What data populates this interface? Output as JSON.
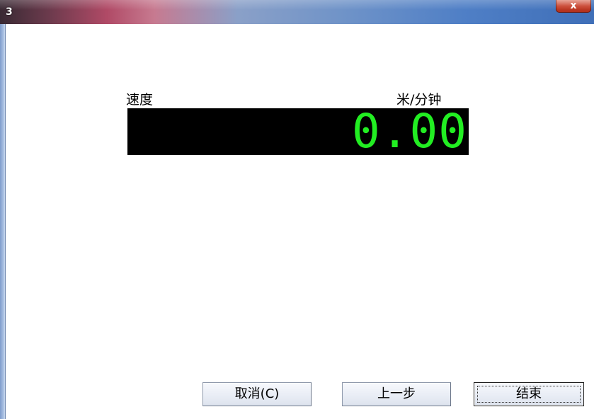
{
  "window": {
    "title": "3",
    "close_label": "x"
  },
  "speed": {
    "label": "速度",
    "unit": "米/分钟",
    "value": "0.00",
    "value_color": "#22ee22",
    "display_bg": "#000000"
  },
  "buttons": {
    "cancel_label": "取消(C)",
    "prev_label": "上一步",
    "finish_label": "结束"
  }
}
